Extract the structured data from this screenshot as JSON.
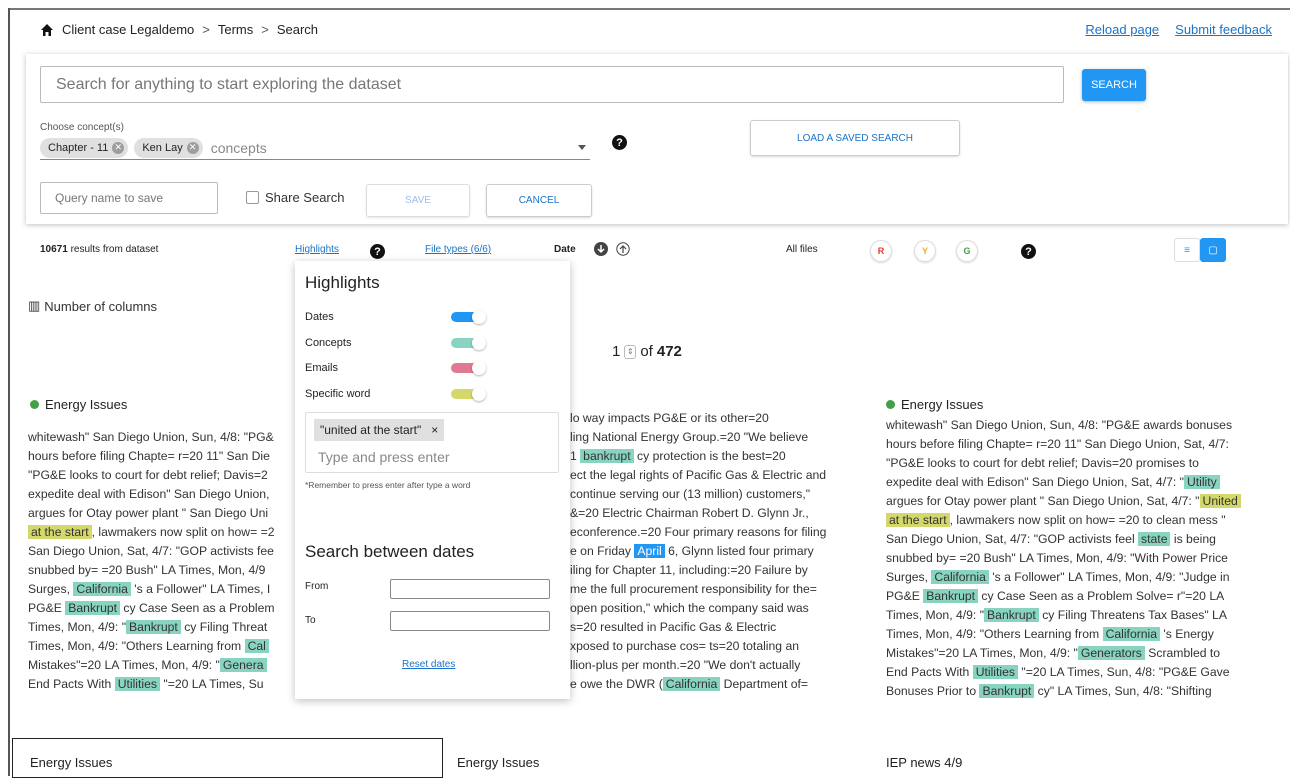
{
  "breadcrumb": {
    "home_icon": "home-icon",
    "items": [
      "Client case Legaldemo",
      "Terms",
      "Search"
    ],
    "separator": ">"
  },
  "toplinks": {
    "reload": "Reload page",
    "feedback": "Submit feedback"
  },
  "search": {
    "placeholder": "Search for anything to start exploring the dataset",
    "button": "SEARCH"
  },
  "concepts": {
    "label": "Choose concept(s)",
    "chips": [
      "Chapter - 11",
      "Ken Lay"
    ],
    "placeholder": "concepts"
  },
  "help_glyph": "?",
  "load_button": "LOAD A SAVED SEARCH",
  "save_area": {
    "query_placeholder": "Query name to save",
    "share_label": "Share Search",
    "save": "SAVE",
    "cancel": "CANCEL"
  },
  "results_bar": {
    "count": "10671",
    "count_suffix": " results from dataset",
    "highlights": "Highlights",
    "file_types": "File types (6/6)",
    "date": "Date",
    "all_files": "All files",
    "r": "R",
    "y": "Y",
    "g": "G"
  },
  "columns_label": "Number of columns",
  "pager": {
    "current": "1",
    "of": "of",
    "total": "472"
  },
  "highlights_panel": {
    "title": "Highlights",
    "rows": [
      {
        "label": "Dates",
        "color": "#2196f3"
      },
      {
        "label": "Concepts",
        "color": "#88d4c0"
      },
      {
        "label": "Emails",
        "color": "#e07a93"
      },
      {
        "label": "Specific word",
        "color": "#d4d86a"
      }
    ],
    "word_chip": "\"united at the start\"",
    "word_chip_close": "×",
    "word_placeholder": "Type and press enter",
    "note": "*Remember to press enter after type a word",
    "dates_title": "Search between dates",
    "from": "From",
    "to": "To",
    "reset": "Reset dates"
  },
  "cards": {
    "left": {
      "title": "Energy Issues",
      "lines": [
        [
          "whitewash\" San Diego Union, Sun, 4/8: \"PG&"
        ],
        [
          "hours before filing Chapte= r=20 11\" San Die"
        ],
        [
          "\"PG&E looks to court for debt relief; Davis=2"
        ],
        [
          "expedite deal with Edison\" San Diego Union,"
        ],
        [
          "argues for Otay power plant \" San Diego Uni"
        ],
        [
          "",
          "at the start",
          ", lawmakers now split on how= =2"
        ],
        [
          "San Diego Union, Sat, 4/7: \"GOP activists fee"
        ],
        [
          "snubbed by= =20 Bush\" LA Times, Mon, 4/9"
        ],
        [
          "Surges, ",
          "California",
          " 's a Follower\" LA Times, I"
        ],
        [
          "PG&E ",
          "Bankrupt",
          " cy Case Seen as a Problem"
        ],
        [
          "Times, Mon, 4/9: \"",
          "Bankrupt",
          " cy Filing Threat"
        ],
        [
          "Times, Mon, 4/9: \"Others Learning from ",
          "Cal"
        ],
        [
          "Mistakes\"=20 LA Times, Mon, 4/9: \"",
          "Genera"
        ],
        [
          "End Pacts With ",
          "Utilities",
          " \"=20 LA Times, Su"
        ]
      ]
    },
    "middle": {
      "lines": [
        [
          "lo way impacts PG&E or its other=20"
        ],
        [
          "ling National Energy Group.=20 \"We believe"
        ],
        [
          "1 ",
          "bankrupt",
          " cy protection is the best=20"
        ],
        [
          "ect the legal rights of Pacific Gas & Electric and"
        ],
        [
          "continue serving our (13 million) customers,\""
        ],
        [
          "&=20 Electric Chairman Robert D. Glynn Jr.,"
        ],
        [
          "econference.=20 Four primary reasons for filing"
        ],
        [
          "e on Friday ",
          "April",
          " 6, Glynn listed four primary"
        ],
        [
          "iling for Chapter 11, including:=20 Failure by"
        ],
        [
          "me the full procurement responsibility for the="
        ],
        [
          "open position,\" which the company said was"
        ],
        [
          "s=20 resulted in Pacific Gas & Electric"
        ],
        [
          "xposed to purchase cos= ts=20 totaling an"
        ],
        [
          "llion-plus per month.=20 \"We don't actually"
        ],
        [
          "e owe the DWR (",
          "California",
          " Department of="
        ]
      ]
    },
    "right": {
      "title": "Energy Issues",
      "lines": [
        [
          "whitewash\" San Diego Union, Sun, 4/8: \"PG&E awards bonuses"
        ],
        [
          "hours before filing Chapte= r=20 11\" San Diego Union, Sat, 4/7:"
        ],
        [
          "\"PG&E looks to court for debt relief; Davis=20 promises to"
        ],
        [
          "expedite deal with Edison\" San Diego Union, Sat, 4/7: \"",
          "Utility"
        ],
        [
          "argues for Otay power plant \" San Diego Union, Sat, 4/7: \"",
          "United"
        ],
        [
          "",
          "at the start",
          ", lawmakers now split on how= =20 to clean mess \""
        ],
        [
          "San Diego Union, Sat, 4/7: \"GOP activists feel ",
          "state",
          " is being"
        ],
        [
          "snubbed by= =20 Bush\" LA Times, Mon, 4/9: \"With Power Price"
        ],
        [
          "Surges, ",
          "California",
          " 's a Follower\" LA Times, Mon, 4/9: \"Judge in"
        ],
        [
          "PG&E ",
          "Bankrupt",
          " cy Case Seen as a Problem Solve= r\"=20 LA"
        ],
        [
          "Times, Mon, 4/9: \"",
          "Bankrupt",
          " cy Filing Threatens Tax Bases\" LA"
        ],
        [
          "Times, Mon, 4/9: \"Others Learning from ",
          "California",
          " 's Energy"
        ],
        [
          "Mistakes\"=20 LA Times, Mon, 4/9: \"",
          "Generators",
          " Scrambled to"
        ],
        [
          "End Pacts With ",
          "Utilities",
          " \"=20 LA Times, Sun, 4/8: \"PG&E Gave"
        ],
        [
          "Bonuses Prior to ",
          "Bankrupt",
          " cy\" LA Times, Sun, 4/8: \"Shifting"
        ]
      ]
    }
  },
  "bottom_titles": [
    "Energy Issues",
    "Energy Issues",
    "IEP news 4/9"
  ]
}
